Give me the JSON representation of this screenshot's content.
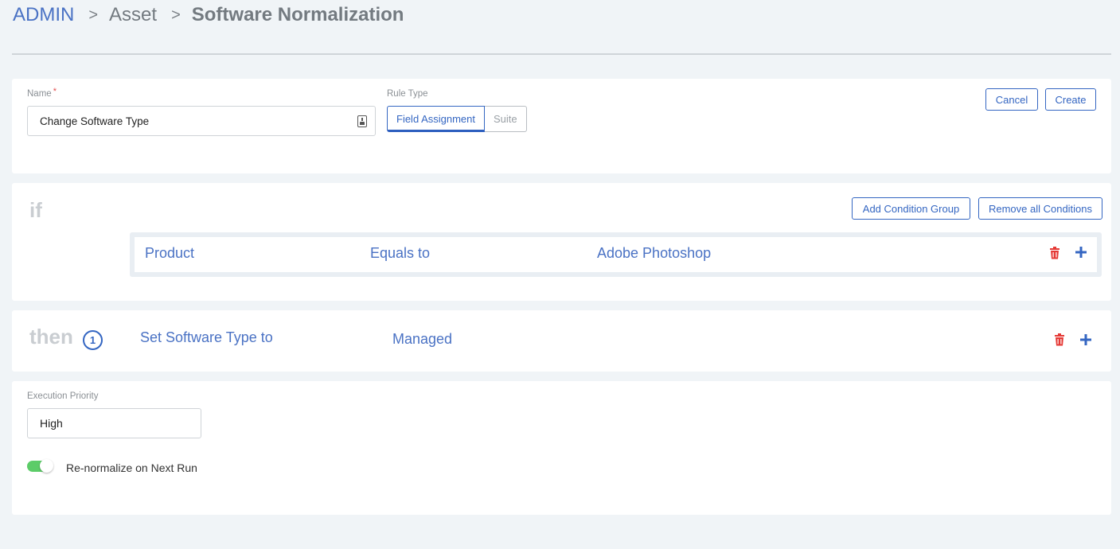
{
  "breadcrumb": {
    "root": "ADMIN",
    "separator": ">",
    "middle": "Asset",
    "current": "Software Normalization"
  },
  "form": {
    "name_label": "Name",
    "name_required_mark": "*",
    "name_value": "Change Software Type",
    "rule_type_label": "Rule Type",
    "rule_type_options": [
      "Field Assignment",
      "Suite"
    ],
    "rule_type_selected": "Field Assignment",
    "cancel_label": "Cancel",
    "create_label": "Create"
  },
  "conditions": {
    "keyword": "if",
    "add_group_label": "Add Condition Group",
    "remove_all_label": "Remove all Conditions",
    "rows": [
      {
        "field": "Product",
        "operator": "Equals to",
        "value": "Adobe Photoshop"
      }
    ]
  },
  "actions": {
    "keyword": "then",
    "count": "1",
    "rows": [
      {
        "action": "Set Software Type to",
        "value": "Managed"
      }
    ]
  },
  "execution": {
    "priority_label": "Execution Priority",
    "priority_value": "High",
    "renormalize_label": "Re-normalize on Next Run",
    "renormalize_enabled": true
  },
  "colors": {
    "accent": "#3466c2",
    "link_text": "#4a72c4",
    "delete": "#e53935",
    "toggle_on": "#5ccc68",
    "background": "#f0f4f7"
  },
  "icons": {
    "name_field": "contact-card-icon",
    "delete": "trash-icon",
    "add": "plus-icon"
  }
}
